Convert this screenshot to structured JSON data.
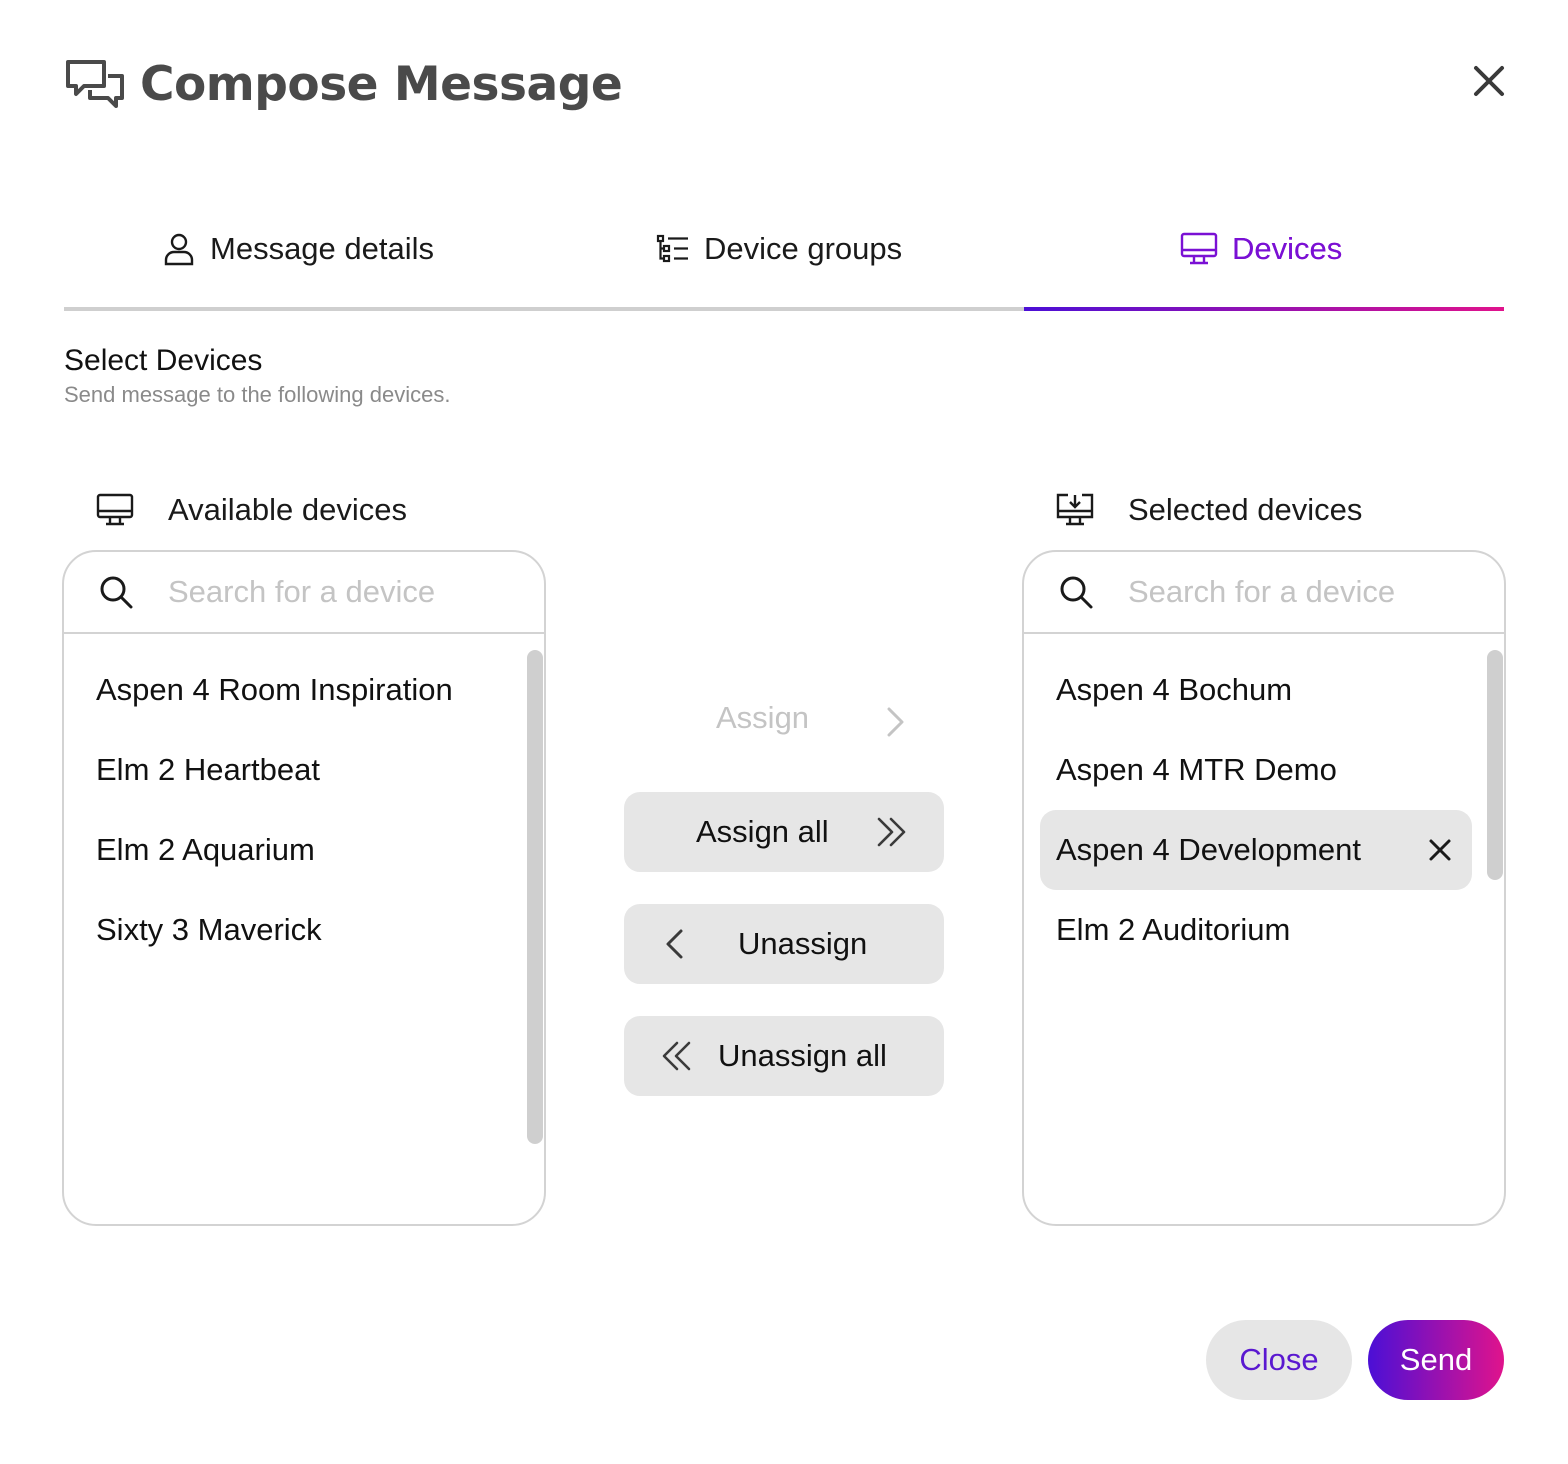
{
  "dialog": {
    "title": "Compose Message",
    "icon": "chat-bubbles-icon",
    "close_icon": "close-icon"
  },
  "tabs": [
    {
      "label": "Message details",
      "icon": "person-icon",
      "active": false
    },
    {
      "label": "Device groups",
      "icon": "tree-list-icon",
      "active": false
    },
    {
      "label": "Devices",
      "icon": "monitor-icon",
      "active": true
    }
  ],
  "section": {
    "title": "Select Devices",
    "subtitle": "Send message to the following devices."
  },
  "available": {
    "label": "Available devices",
    "icon": "monitor-icon",
    "search_placeholder": "Search for a device",
    "items": [
      "Aspen 4 Room Inspiration",
      "Elm 2 Heartbeat",
      "Elm 2 Aquarium",
      "Sixty 3 Maverick"
    ]
  },
  "selected": {
    "label": "Selected devices",
    "icon": "monitor-download-icon",
    "search_placeholder": "Search for a device",
    "items": [
      "Aspen 4 Bochum",
      "Aspen 4 MTR Demo",
      "Aspen 4 Development",
      "Elm 2 Auditorium"
    ],
    "highlighted_item": "Aspen 4 Development"
  },
  "actions": {
    "assign": "Assign",
    "assign_all": "Assign all",
    "unassign": "Unassign",
    "unassign_all": "Unassign all"
  },
  "footer": {
    "close": "Close",
    "send": "Send"
  },
  "colors": {
    "accent_start": "#4b0fd6",
    "accent_end": "#e0138c",
    "active_tab_text": "#7a10d4",
    "button_bg": "#e6e6e6"
  }
}
